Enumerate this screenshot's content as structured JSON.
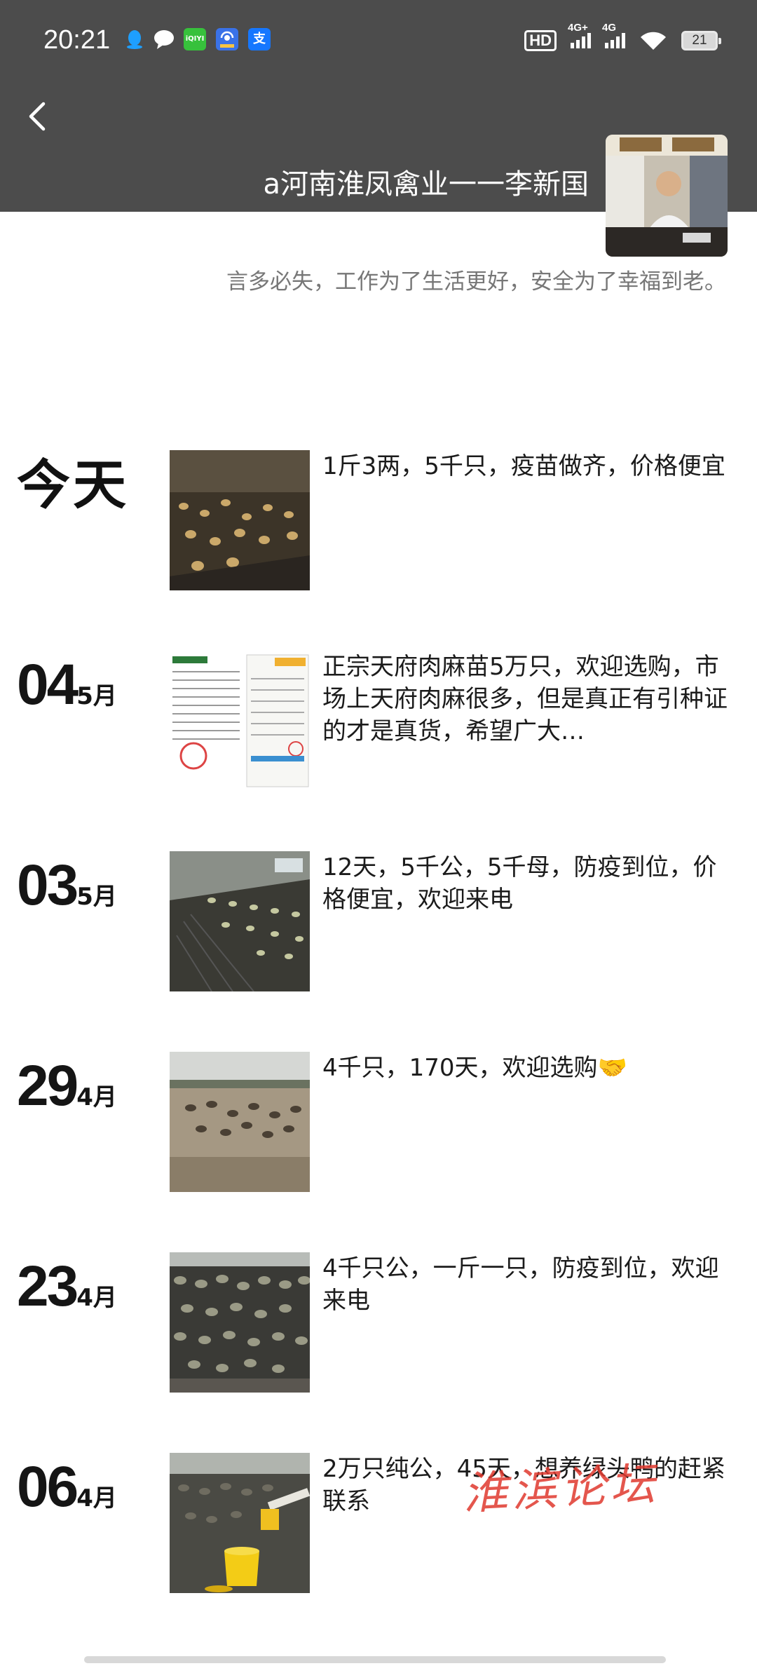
{
  "status_bar": {
    "time": "20:21",
    "apps": [
      {
        "icon": "qq-icon",
        "color": "#1e9fff"
      },
      {
        "icon": "message-bubble-icon",
        "color": "#ffffff"
      },
      {
        "icon": "iqiyi-icon",
        "color": "#37c13c"
      },
      {
        "icon": "broadcast-app-icon",
        "color": "#3a72e8"
      },
      {
        "icon": "alipay-icon",
        "color": "#1677ff"
      }
    ],
    "hd_label": "HD",
    "network_1": "4G+",
    "network_2": "4G",
    "battery": "21"
  },
  "header": {
    "title": "a河南淮凤禽业一一李新国",
    "signature": "言多必失，工作为了生活更好，安全为了幸福到老。"
  },
  "posts": [
    {
      "day": "今天",
      "month": "",
      "text": "1斤3两，5千只，疫苗做齐，价格便宜",
      "image": "ducklings-barn-photo"
    },
    {
      "day": "04",
      "month": "5月",
      "text": "正宗天府肉麻苗5万只，欢迎选购，市场上天府肉麻很多，但是真正有引种证的才是真货，希望广大…",
      "image": "certificate-document-photo"
    },
    {
      "day": "03",
      "month": "5月",
      "text": "12天，5千公，5千母，防疫到位，价格便宜，欢迎来电",
      "image": "ducks-shed-photo"
    },
    {
      "day": "29",
      "month": "4月",
      "text": "4千只，170天，欢迎选购🤝",
      "image": "ducks-field-photo"
    },
    {
      "day": "23",
      "month": "4月",
      "text": "4千只公，一斤一只，防疫到位，欢迎来电",
      "image": "ducks-crowd-photo"
    },
    {
      "day": "06",
      "month": "4月",
      "text": "2万只纯公，45天，想养绿头鸭的赶紧联系",
      "image": "ducks-feeder-photo"
    }
  ],
  "watermark": "淮滨论坛"
}
